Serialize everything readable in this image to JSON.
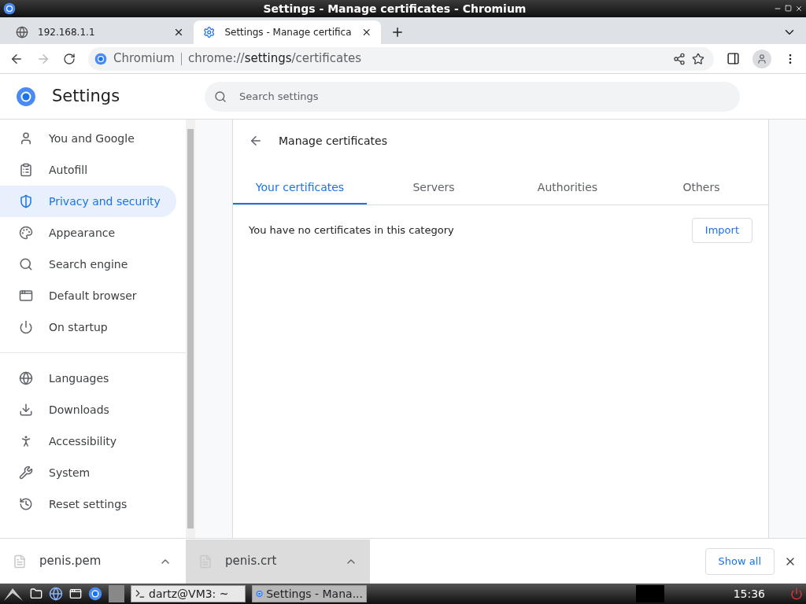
{
  "window": {
    "title": "Settings - Manage certificates - Chromium"
  },
  "tabs": [
    {
      "label": "192.168.1.1",
      "selected": false
    },
    {
      "label": "Settings - Manage certifica",
      "selected": true
    }
  ],
  "address_bar": {
    "site": "Chromium",
    "url_prefix": "chrome://",
    "url_host": "settings",
    "url_path": "/certificates"
  },
  "settings": {
    "title": "Settings",
    "search": {
      "placeholder": "Search settings"
    }
  },
  "sidebar": {
    "groups": [
      [
        {
          "label": "You and Google",
          "selected": false
        },
        {
          "label": "Autofill",
          "selected": false
        },
        {
          "label": "Privacy and security",
          "selected": true
        },
        {
          "label": "Appearance",
          "selected": false
        },
        {
          "label": "Search engine",
          "selected": false
        },
        {
          "label": "Default browser",
          "selected": false
        },
        {
          "label": "On startup",
          "selected": false
        }
      ],
      [
        {
          "label": "Languages",
          "selected": false
        },
        {
          "label": "Downloads",
          "selected": false
        },
        {
          "label": "Accessibility",
          "selected": false
        },
        {
          "label": "System",
          "selected": false
        },
        {
          "label": "Reset settings",
          "selected": false
        }
      ]
    ]
  },
  "page": {
    "title": "Manage certificates",
    "tabs": [
      {
        "label": "Your certificates",
        "selected": true
      },
      {
        "label": "Servers",
        "selected": false
      },
      {
        "label": "Authorities",
        "selected": false
      },
      {
        "label": "Others",
        "selected": false
      }
    ],
    "empty_message": "You have no certificates in this category",
    "import_button": "Import"
  },
  "downloads": {
    "items": [
      {
        "name": "penis.pem",
        "selected": false
      },
      {
        "name": "penis.crt",
        "selected": true
      }
    ],
    "show_all": "Show all"
  },
  "taskbar": {
    "tasks": [
      {
        "label": "dartz@VM3: ~",
        "selected": false
      },
      {
        "label": "Settings - Mana...",
        "selected": true
      }
    ],
    "clock": "15:36"
  }
}
